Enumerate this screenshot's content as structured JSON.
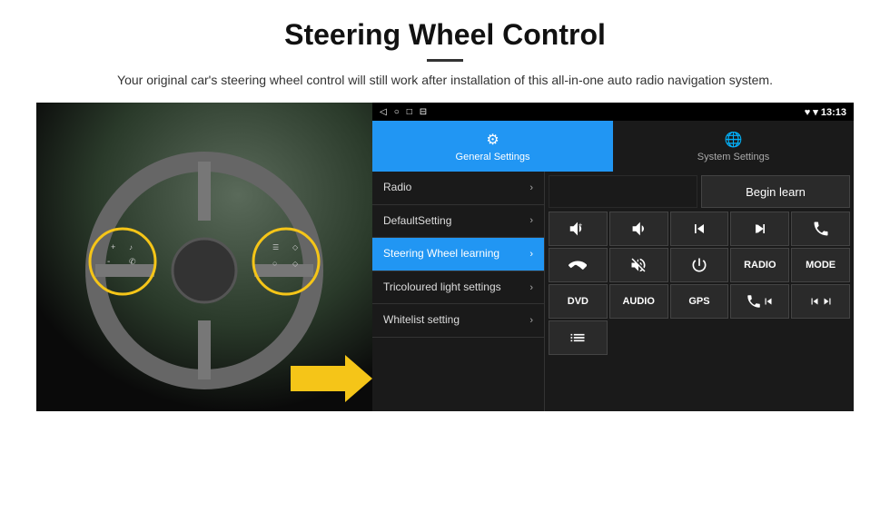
{
  "header": {
    "title": "Steering Wheel Control",
    "subtitle": "Your original car's steering wheel control will still work after installation of this all-in-one auto radio navigation system."
  },
  "status_bar": {
    "icons": [
      "◁",
      "○",
      "□",
      "⊟"
    ],
    "right_icons": "♥ ▾",
    "time": "13:13"
  },
  "tabs": [
    {
      "label": "General Settings",
      "icon": "⚙",
      "active": true
    },
    {
      "label": "System Settings",
      "icon": "🌐",
      "active": false
    }
  ],
  "menu": [
    {
      "label": "Radio",
      "active": false
    },
    {
      "label": "DefaultSetting",
      "active": false
    },
    {
      "label": "Steering Wheel learning",
      "active": true
    },
    {
      "label": "Tricoloured light settings",
      "active": false
    },
    {
      "label": "Whitelist setting",
      "active": false
    }
  ],
  "controls": {
    "begin_learn": "Begin learn",
    "row1": [
      "🔊+",
      "🔊-",
      "⏮",
      "⏭",
      "📞"
    ],
    "row2": [
      "📞",
      "🔇",
      "⏻",
      "RADIO",
      "MODE"
    ],
    "row3_labels": [
      "DVD",
      "AUDIO",
      "GPS",
      "📞⏮",
      "⏮⏭"
    ],
    "row4": [
      "⊟"
    ]
  }
}
